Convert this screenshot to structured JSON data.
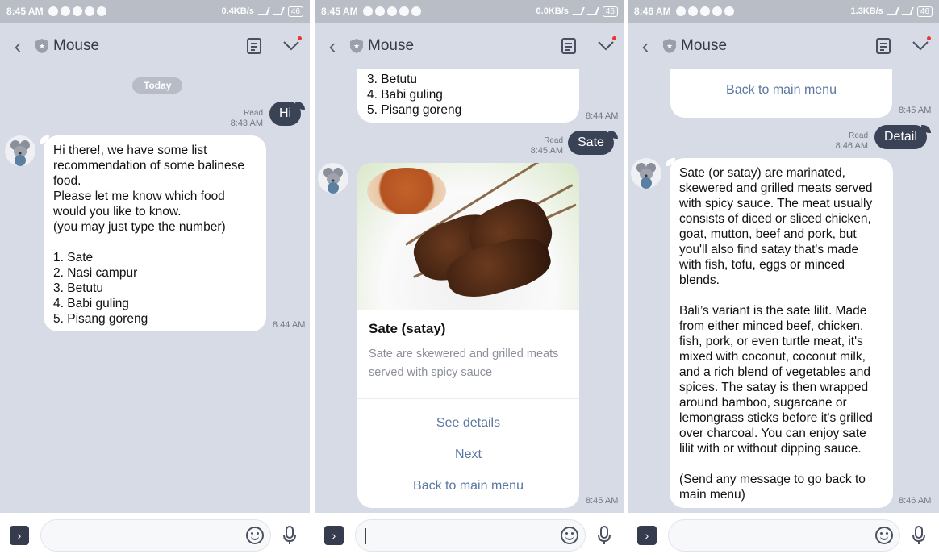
{
  "panels": [
    {
      "status": {
        "time": "8:45 AM",
        "speed": "0.4KB/s",
        "battery": "46"
      },
      "header": {
        "title": "Mouse"
      },
      "date_chip": "Today",
      "me": {
        "text": "Hi",
        "read": "Read",
        "time": "8:43 AM"
      },
      "bot": {
        "text": "Hi there!, we have some list recommendation of some balinese food.\nPlease let me know which food would you like to know.\n(you may just type the number)\n\n1. Sate\n2. Nasi campur\n3. Betutu\n4. Babi guling\n5. Pisang goreng",
        "time": "8:44 AM"
      }
    },
    {
      "status": {
        "time": "8:45 AM",
        "speed": "0.0KB/s",
        "battery": "46"
      },
      "header": {
        "title": "Mouse"
      },
      "prev": {
        "text": "3. Betutu\n4. Babi guling\n5. Pisang goreng",
        "time": "8:44 AM"
      },
      "me": {
        "text": "Sate",
        "read": "Read",
        "time": "8:45 AM"
      },
      "card": {
        "name": "Sate (satay)",
        "desc": "Sate are skewered and grilled meats served with spicy sauce",
        "actions": [
          "See details",
          "Next",
          "Back to main menu"
        ],
        "time": "8:45 AM"
      }
    },
    {
      "status": {
        "time": "8:46 AM",
        "speed": "1.3KB/s",
        "battery": "46"
      },
      "header": {
        "title": "Mouse"
      },
      "prev": {
        "action": "Back to main menu",
        "time": "8:45 AM"
      },
      "me": {
        "text": "Detail",
        "read": "Read",
        "time": "8:46 AM"
      },
      "bot": {
        "text": "Sate (or satay) are marinated, skewered and grilled meats served with spicy sauce. The meat usually consists of diced or sliced chicken, goat, mutton, beef and pork, but you'll also find satay that's made with fish, tofu, eggs or minced blends.\n\nBali’s variant is the sate lilit. Made from either minced beef, chicken, fish, pork, or even turtle meat, it's mixed with coconut, coconut milk, and a rich blend of vegetables and spices. The satay is then wrapped around bamboo, sugarcane or lemongrass sticks before it's grilled over charcoal. You can enjoy sate lilit with or without dipping sauce.\n\n(Send any message to go back to main menu)",
        "time": "8:46 AM"
      }
    }
  ],
  "icons": {
    "back": "chevron-left-icon",
    "notes": "notes-icon",
    "menu": "chevron-down-icon",
    "plus": "chevron-right-icon",
    "emoji": "emoji-icon",
    "mic": "microphone-icon"
  },
  "colors": {
    "chat_bg": "#d7dbe5",
    "my_bubble": "#3a4256",
    "link": "#5a77a0"
  }
}
